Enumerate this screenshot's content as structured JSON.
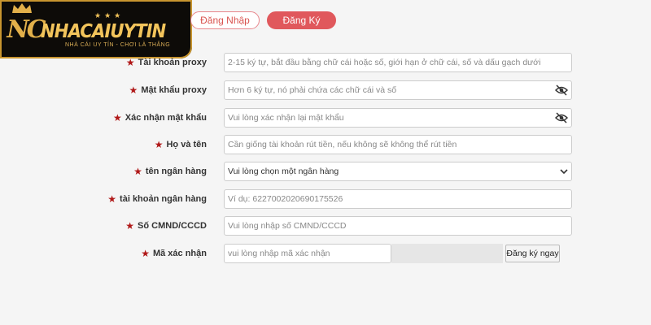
{
  "logo": {
    "brand": "NHACAIUYTIN",
    "mark": "NC",
    "tagline": "NHÀ CÁI UY TÍN - CHƠI LÀ THẮNG"
  },
  "tabs": [
    {
      "label": "Đăng Nhập",
      "active": false
    },
    {
      "label": "Đăng Ký",
      "active": true
    }
  ],
  "form": {
    "fields": [
      {
        "label": "Tài khoản proxy",
        "placeholder": "2-15 ký tự, bắt đầu bằng chữ cái hoặc số, giới hạn ở chữ cái, số và dấu gạch dưới",
        "icon": ""
      },
      {
        "label": "Mật khẩu proxy",
        "placeholder": "Hơn 6 ký tự, nó phải chứa các chữ cái và số",
        "icon": "eye-slash-icon"
      },
      {
        "label": "Xác nhận mật khẩu",
        "placeholder": "Vui lòng xác nhận lại mật khẩu",
        "icon": "eye-slash-icon"
      },
      {
        "label": "Họ và tên",
        "placeholder": "Cần giống tài khoản rút tiền, nếu không sẽ không thể rút tiền",
        "icon": ""
      },
      {
        "label": "tên ngân hàng",
        "placeholder": "Vui lòng chọn một ngân hàng",
        "icon": "chevron-down-icon"
      },
      {
        "label": "tài khoản ngân hàng",
        "placeholder": "Ví dụ: 6227002020690175526",
        "icon": ""
      },
      {
        "label": "Số CMND/CCCD",
        "placeholder": "Vui lòng nhập số CMND/CCCD",
        "icon": ""
      }
    ],
    "captcha": {
      "label": "Mã xác nhận",
      "placeholder": "vui lòng nhập mã xác nhận"
    },
    "submit_label": "Đăng ký ngay"
  },
  "colors": {
    "accent": "#e0585c",
    "required_star": "#b01818",
    "logo_gold": "#f2c45b",
    "logo_bg": "#0d0b08"
  }
}
